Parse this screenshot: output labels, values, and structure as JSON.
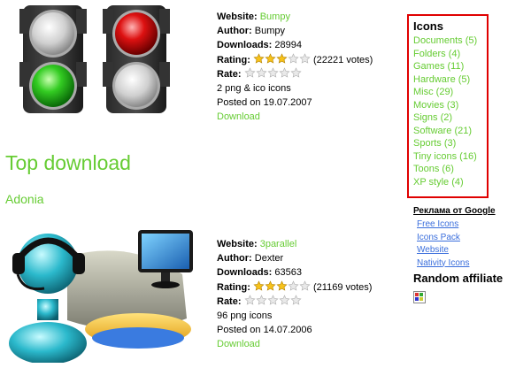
{
  "item1": {
    "website_label": "Website:",
    "website": "Bumpy",
    "author_label": "Author:",
    "author": "Bumpy",
    "downloads_label": "Downloads:",
    "downloads": "28994",
    "rating_label": "Rating:",
    "rating_stars": 3,
    "rating_votes": "(22221 votes)",
    "rate_label": "Rate:",
    "details": "2 png & ico icons",
    "posted": "Posted on 19.07.2007",
    "download_link": "Download"
  },
  "top_download": "Top download",
  "item2_title": "Adonia",
  "item2": {
    "website_label": "Website:",
    "website": "3parallel",
    "author_label": "Author:",
    "author": "Dexter",
    "downloads_label": "Downloads:",
    "downloads": "63563",
    "rating_label": "Rating:",
    "rating_stars": 3,
    "rating_votes": "(21169 votes)",
    "rate_label": "Rate:",
    "details": "96 png icons",
    "posted": "Posted on 14.07.2006",
    "download_link": "Download"
  },
  "icons_box": {
    "title": "Icons",
    "categories": [
      "Documents (5)",
      "Folders (4)",
      "Games (11)",
      "Hardware (5)",
      "Misc (29)",
      "Movies (3)",
      "Signs (2)",
      "Software (21)",
      "Sports (3)",
      "Tiny icons (16)",
      "Toons (6)",
      "XP style (4)"
    ]
  },
  "ads": {
    "title": "Реклама от Google",
    "links": [
      "Free Icons",
      "Icons Pack",
      "Website",
      "Nativity Icons"
    ]
  },
  "affiliate_title": "Random affiliate",
  "colors": {
    "accent_green": "#66cc33",
    "box_border": "#e00000",
    "ad_link": "#3a6edc"
  }
}
